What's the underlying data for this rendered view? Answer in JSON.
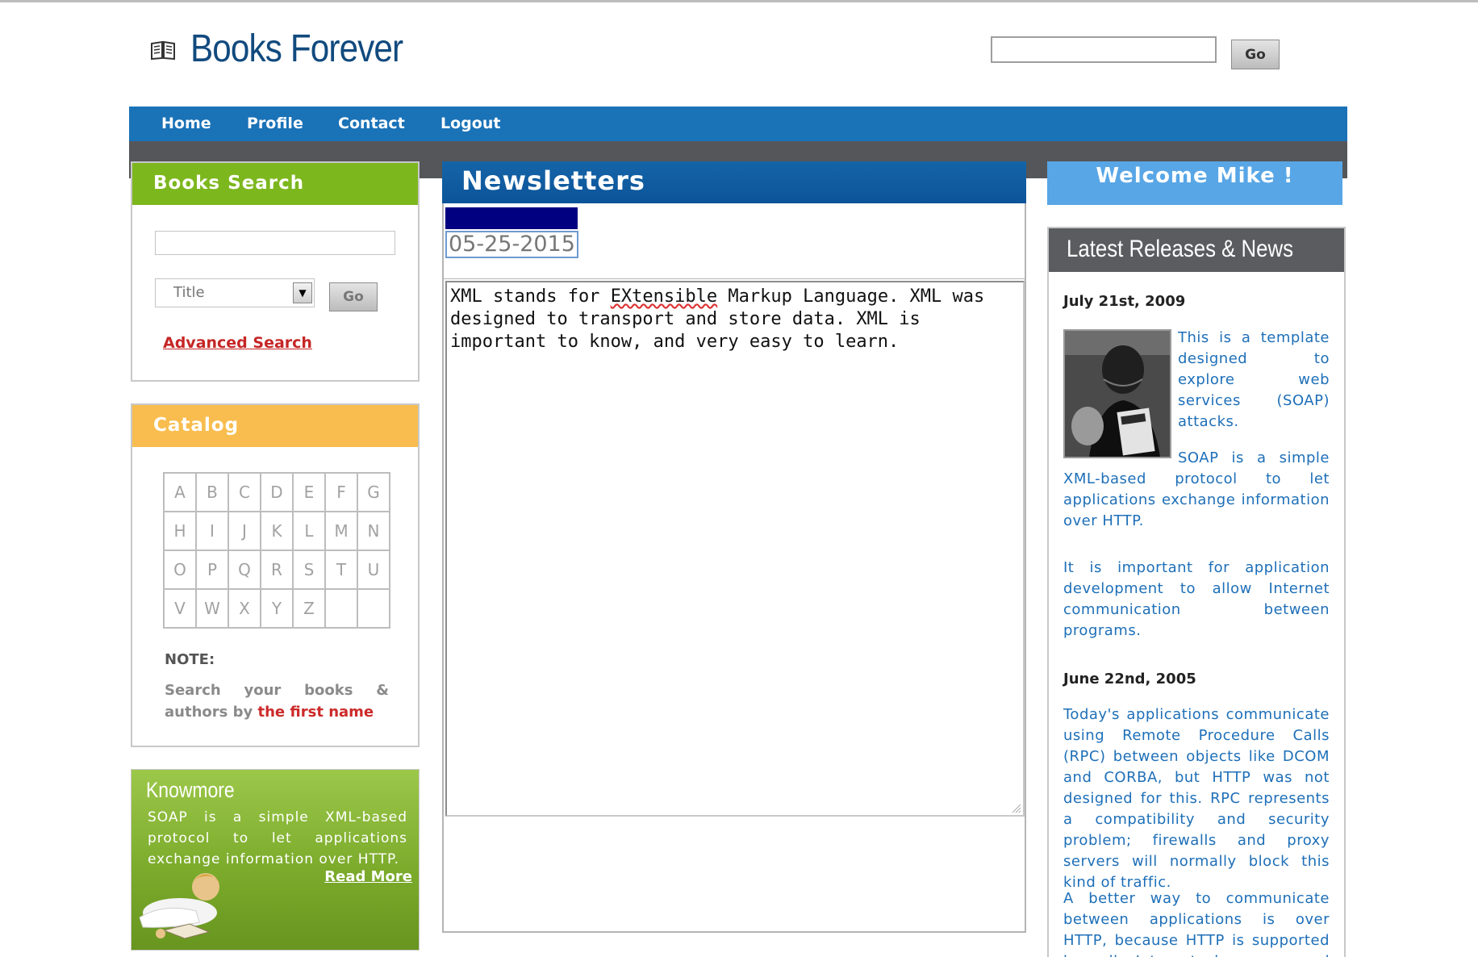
{
  "header": {
    "site_title": "Books Forever",
    "search_placeholder": "",
    "go_label": "Go"
  },
  "nav": {
    "items": [
      {
        "label": "Home"
      },
      {
        "label": "Profile"
      },
      {
        "label": "Contact"
      },
      {
        "label": "Logout"
      }
    ]
  },
  "books_search": {
    "title": "Books Search",
    "input_value": "",
    "select_value": "Title",
    "go_label": "Go",
    "advanced_link": "Advanced Search"
  },
  "catalog": {
    "title": "Catalog",
    "rows": [
      [
        "A",
        "B",
        "C",
        "D",
        "E",
        "F",
        "G"
      ],
      [
        "H",
        "I",
        "J",
        "K",
        "L",
        "M",
        "N"
      ],
      [
        "O",
        "P",
        "Q",
        "R",
        "S",
        "T",
        "U"
      ],
      [
        "V",
        "W",
        "X",
        "Y",
        "Z",
        "",
        ""
      ]
    ],
    "note_label": "NOTE:",
    "note_text": "Search your books & authors by ",
    "note_highlight": "the first name"
  },
  "knowmore": {
    "title": "Knowmore",
    "text": "SOAP is a simple XML-based protocol to let applications exchange information over HTTP.",
    "read_more": "Read More"
  },
  "newsletters": {
    "title": "Newsletters",
    "date": "05-25-2015",
    "content_before": "XML stands for ",
    "content_squiggle": "EXtensible",
    "content_after": " Markup Language. XML was designed to transport and store data. XML is important to know, and very easy to learn."
  },
  "welcome": {
    "text": "Welcome Mike !"
  },
  "latest": {
    "title": "Latest Releases & News",
    "items": [
      {
        "date": "July 21st, 2009",
        "p1": "This is a template designed to explore web services (SOAP) attacks.",
        "p2": "SOAP is a simple XML-based protocol to let applications exchange information over HTTP.",
        "p3": "It is important for application development to allow Internet communication between programs."
      },
      {
        "date": "June 22nd, 2005",
        "p1": "Today's applications communicate using Remote Procedure Calls (RPC) between objects like DCOM and CORBA, but HTTP was not designed for this. RPC represents a compatibility and security problem; firewalls and proxy servers will normally block this kind of traffic.",
        "p2": "A better way to communicate between applications is over HTTP, because HTTP is supported by all Internet browsers and servers."
      }
    ]
  },
  "colors": {
    "nav_blue": "#1a72b7",
    "search_green": "#7db71e",
    "catalog_orange": "#f8bd4e",
    "welcome_blue": "#58a6e6",
    "news_text_blue": "#1e6fb8",
    "link_red": "#c62626"
  }
}
